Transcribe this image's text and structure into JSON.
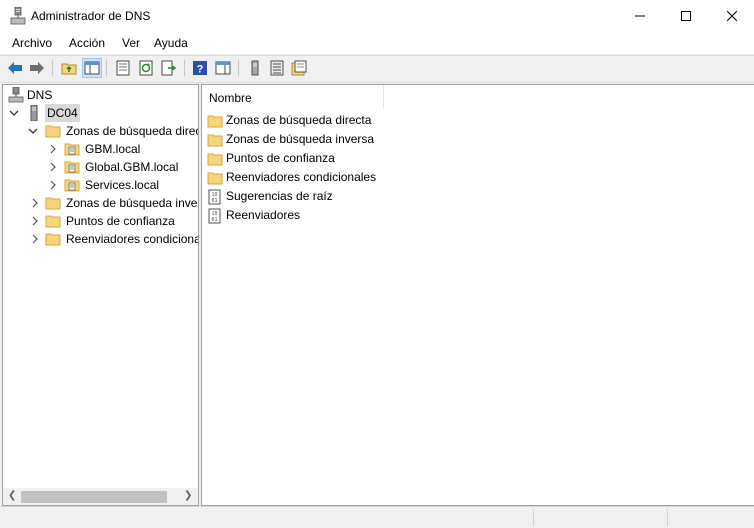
{
  "window": {
    "title": "Administrador de DNS"
  },
  "menu": [
    "Archivo",
    "Acción",
    "Ver",
    "Ayuda"
  ],
  "tree": {
    "root": "DNS",
    "server": "DC04",
    "forward_zones": "Zonas de búsqueda directa",
    "zones": [
      "GBM.local",
      "Global.GBM.local",
      "Services.local"
    ],
    "reverse_zones": "Zonas de búsqueda inversa",
    "trust_points": "Puntos de confianza",
    "conditional_forwarders": "Reenviadores condicionales"
  },
  "list": {
    "column_name": "Nombre",
    "items": [
      {
        "label": "Zonas de búsqueda directa",
        "icon": "folder-icon"
      },
      {
        "label": "Zonas de búsqueda inversa",
        "icon": "folder-icon"
      },
      {
        "label": "Puntos de confianza",
        "icon": "folder-icon"
      },
      {
        "label": "Reenviadores condicionales",
        "icon": "folder-icon"
      },
      {
        "label": "Sugerencias de raíz",
        "icon": "properties-icon"
      },
      {
        "label": "Reenviadores",
        "icon": "properties-icon"
      }
    ]
  },
  "colors": {
    "folder": "#f5d67a",
    "folder_border": "#d9a640",
    "arrow_blue": "#1e73be",
    "selection": "#d9d9d9"
  }
}
